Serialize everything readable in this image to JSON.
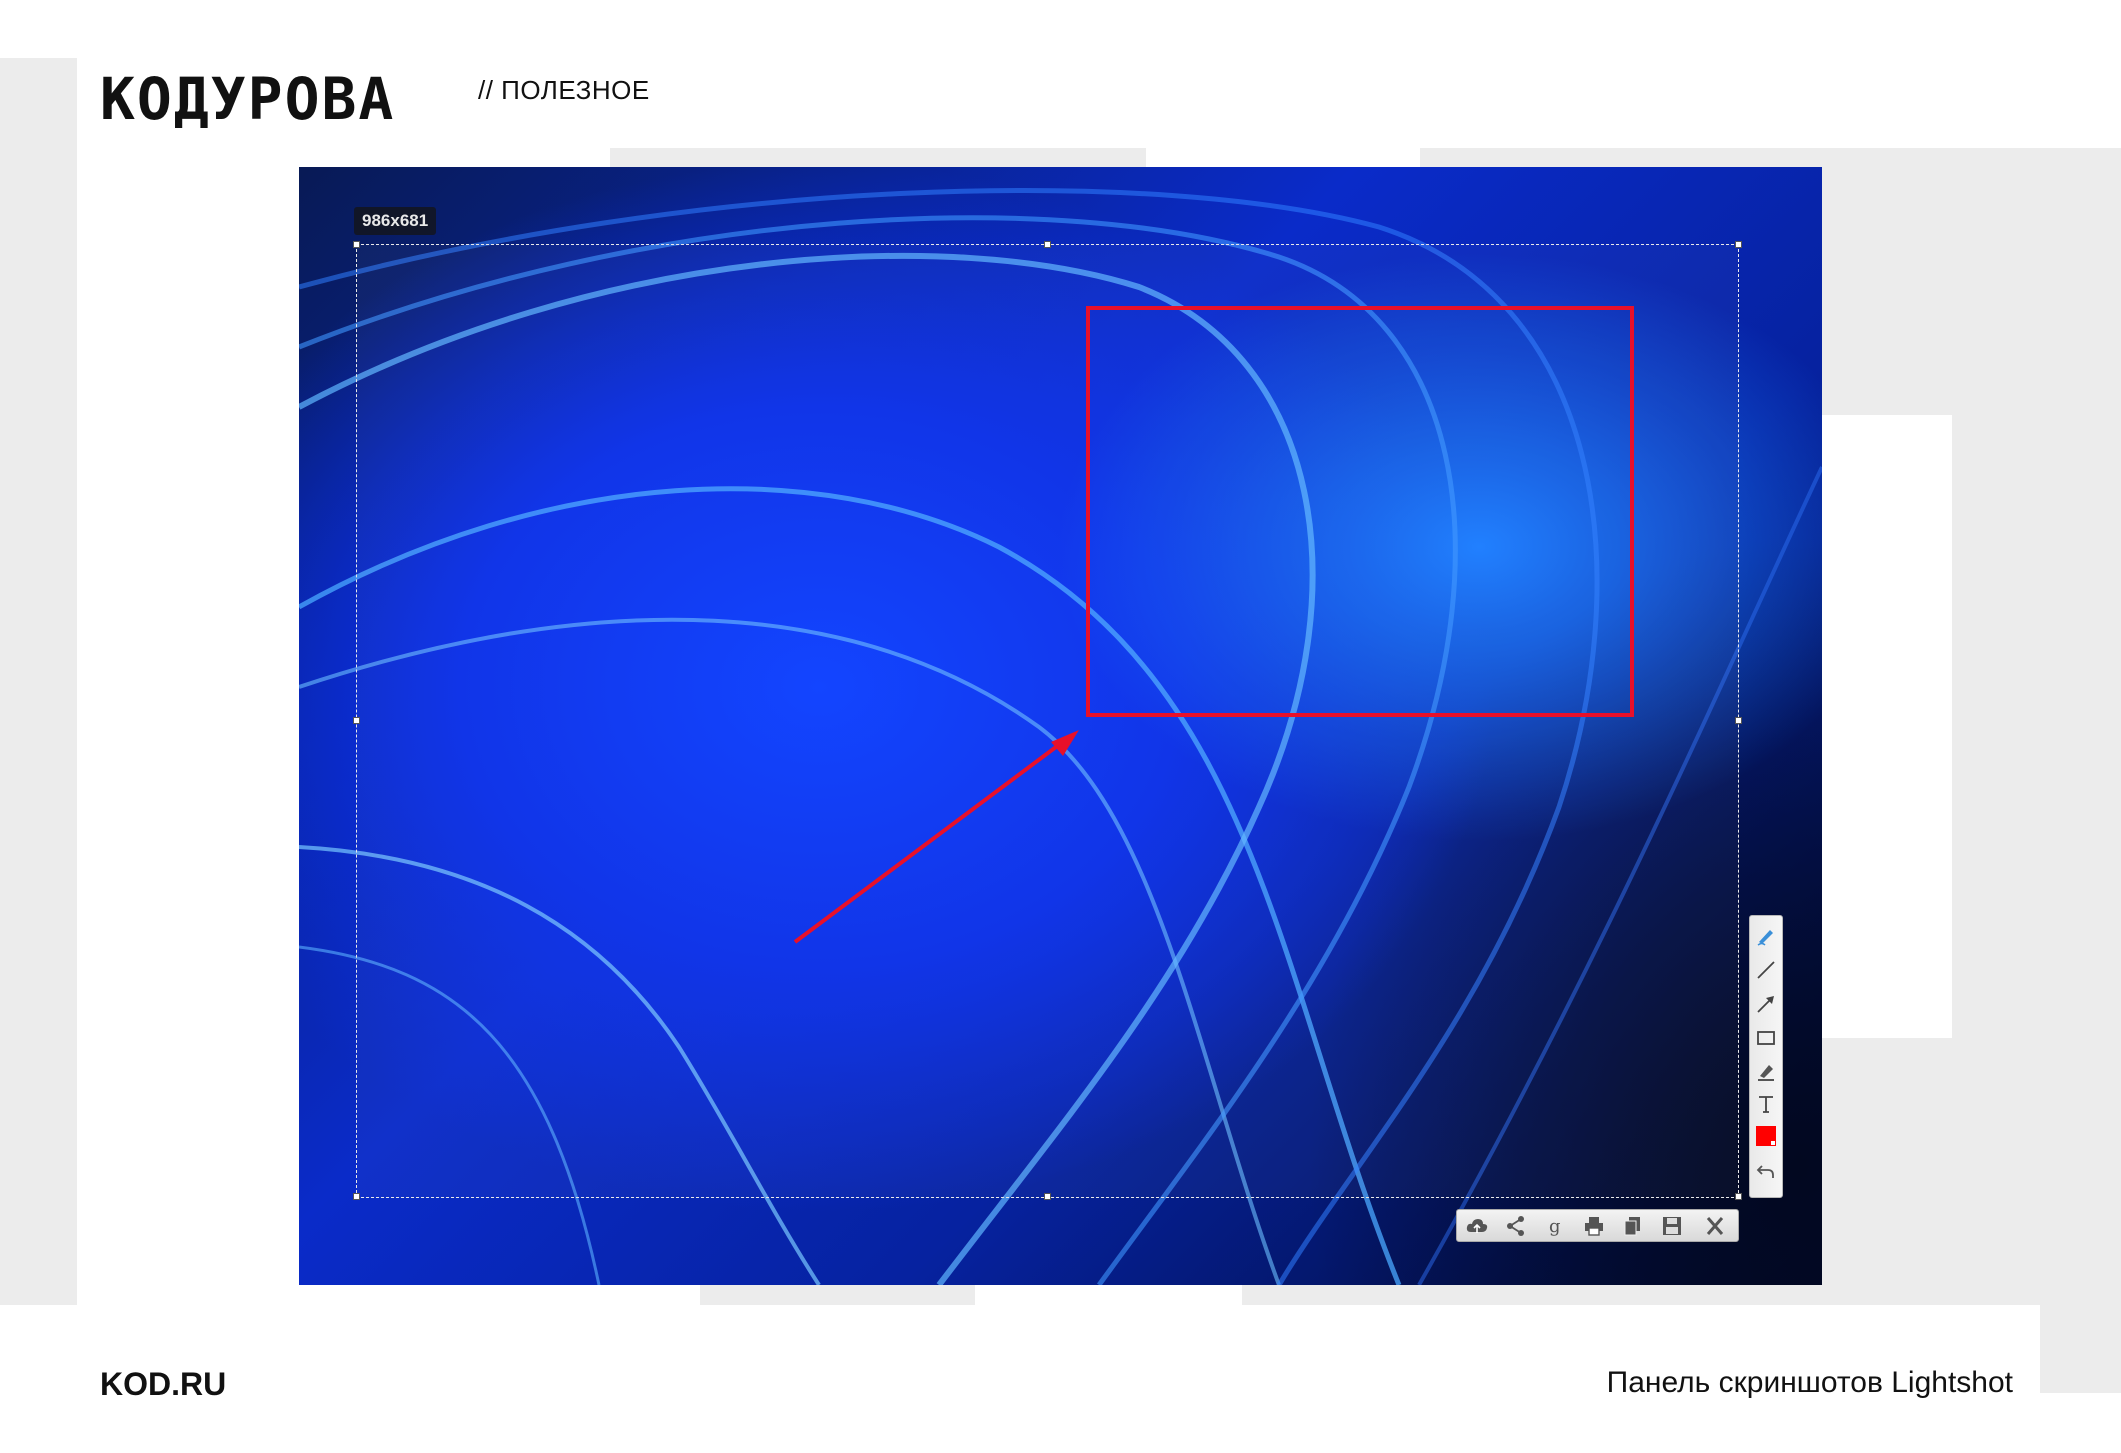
{
  "header": {
    "logo_text": "КОДУРОВА",
    "section_label": "// ПОЛЕЗНОЕ"
  },
  "screenshot": {
    "dimensions_label": "986x681",
    "annotation_color": "#e8102a",
    "tools": [
      {
        "name": "pen-icon",
        "label": "Pen"
      },
      {
        "name": "line-icon",
        "label": "Line"
      },
      {
        "name": "arrow-icon",
        "label": "Arrow"
      },
      {
        "name": "rectangle-icon",
        "label": "Rectangle"
      },
      {
        "name": "marker-icon",
        "label": "Marker"
      },
      {
        "name": "text-icon",
        "label": "Text"
      },
      {
        "name": "color-picker-icon",
        "label": "Color"
      },
      {
        "name": "undo-icon",
        "label": "Undo"
      }
    ],
    "actions": [
      {
        "name": "upload-cloud-icon"
      },
      {
        "name": "share-icon"
      },
      {
        "name": "google-search-icon"
      },
      {
        "name": "print-icon"
      },
      {
        "name": "copy-icon"
      },
      {
        "name": "save-icon"
      },
      {
        "name": "close-icon"
      }
    ]
  },
  "footer": {
    "site": "KOD.RU",
    "caption": "Панель скриншотов Lightshot"
  }
}
